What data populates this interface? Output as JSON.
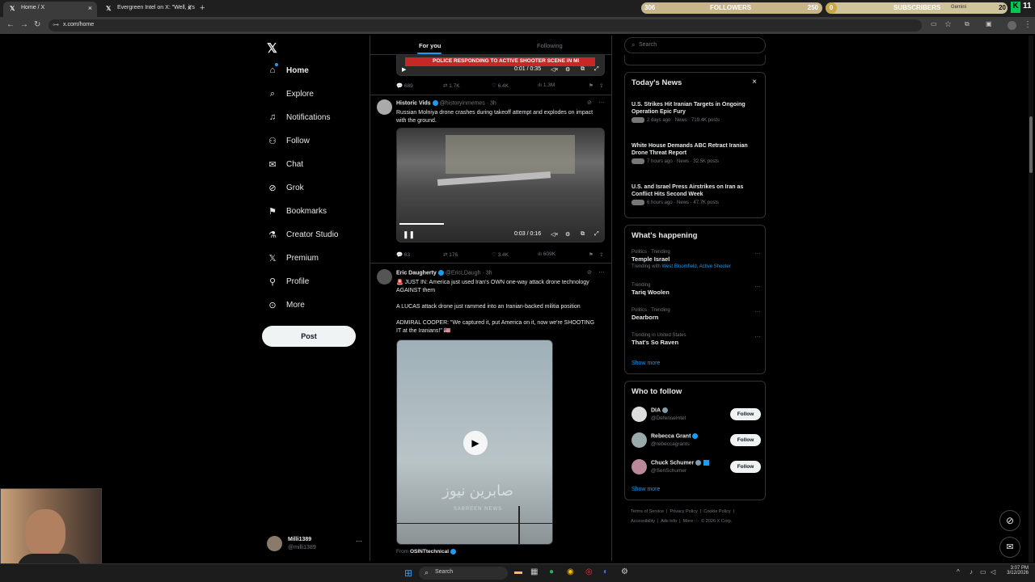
{
  "browser": {
    "tabs": [
      {
        "title": "Home / X",
        "active": true
      },
      {
        "title": "Evergreen Intel on X: \"Well, it's"
      }
    ],
    "url": "x.com/home"
  },
  "overlays": {
    "followers_left": "306",
    "followers_label": "FOLLOWERS",
    "followers_right": "250",
    "subs_left": "0",
    "subscribers_label": "SUBSCRIBERS",
    "gemini_label": "Gemini",
    "subs_right": "20",
    "corner_num": "11"
  },
  "nav": {
    "items": [
      {
        "label": "Home",
        "icon": "home-icon"
      },
      {
        "label": "Explore",
        "icon": "search-icon"
      },
      {
        "label": "Notifications",
        "icon": "bell-icon"
      },
      {
        "label": "Follow",
        "icon": "person-add-icon"
      },
      {
        "label": "Chat",
        "icon": "mail-icon"
      },
      {
        "label": "Grok",
        "icon": "grok-icon"
      },
      {
        "label": "Bookmarks",
        "icon": "bookmark-icon"
      },
      {
        "label": "Creator Studio",
        "icon": "flask-icon"
      },
      {
        "label": "Premium",
        "icon": "x-icon"
      },
      {
        "label": "Profile",
        "icon": "person-icon"
      },
      {
        "label": "More",
        "icon": "more-circle-icon"
      }
    ],
    "post_label": "Post",
    "account_name": "Milli1389",
    "account_handle": "@milli1389"
  },
  "feed": {
    "tab_for_you": "For you",
    "tab_following": "Following",
    "top_video_banner": "POLICE RESPONDING TO ACTIVE SHOOTER SCENE IN MI",
    "top_video_time": "0:01 / 0:35",
    "top_actions": {
      "replies": "689",
      "reposts": "1.7K",
      "likes": "6.4K",
      "views": "1.3M"
    },
    "tweet1": {
      "name": "Historic Vids",
      "handle": "@historyinmemes · 3h",
      "text": "Russian Molniya drone crashes during takeoff attempt and explodes on impact with the ground.",
      "video_time": "0:03 / 0:16",
      "replies": "63",
      "reposts": "176",
      "likes": "3.4K",
      "views": "609K"
    },
    "tweet2": {
      "name": "Eric Daugherty",
      "handle": "@EricLDaugh · 3h",
      "line1": "🚨 JUST IN: America just used Iran's OWN one-way attack drone technology AGAINST them",
      "line2": "A LUCAS attack drone just rammed into an Iranian-backed militia position",
      "line3": "ADMIRAL COOPER: \"We captured it, put America on it, now we're SHOOTING IT at the Iranians!\" 🇺🇸",
      "watermark": "صابرين نيوز",
      "watermark_sub": "SABREEN NEWS",
      "from_label": "From",
      "from_account": "OSINTtechnical"
    }
  },
  "sidebar": {
    "search_placeholder": "Search",
    "todays_news": {
      "title": "Today's News",
      "items": [
        {
          "title": "U.S. Strikes Hit Iranian Targets in Ongoing Operation Epic Fury",
          "meta": "2 days ago · News · 719.4K posts"
        },
        {
          "title": "White House Demands ABC Retract Iranian Drone Threat Report",
          "meta": "7 hours ago · News · 32.5K posts"
        },
        {
          "title": "U.S. and Israel Press Airstrikes on Iran as Conflict Hits Second Week",
          "meta": "6 hours ago · News · 47.7K posts"
        }
      ]
    },
    "whats_happening": {
      "title": "What's happening",
      "trends": [
        {
          "category": "Politics · Trending",
          "name": "Temple Israel",
          "extra_prefix": "Trending with ",
          "extra_links": "West Bloomfield, Active Shooter"
        },
        {
          "category": "Trending",
          "name": "Tariq Woolen"
        },
        {
          "category": "Politics · Trending",
          "name": "Dearborn"
        },
        {
          "category": "Trending in United States",
          "name": "That's So Raven"
        }
      ],
      "show_more": "Show more"
    },
    "who_to_follow": {
      "title": "Who to follow",
      "users": [
        {
          "name": "DIA",
          "handle": "@DefenseIntel"
        },
        {
          "name": "Rebecca Grant",
          "handle": "@rebeccagrants"
        },
        {
          "name": "Chuck Schumer",
          "handle": "@SenSchumer"
        }
      ],
      "follow_label": "Follow",
      "show_more": "Show more"
    },
    "footer": {
      "line1": "Terms of Service  |  Privacy Policy  |  Cookie Policy  |",
      "line2": "Accessibility  |  Ads info  |  More ···  © 2026 X Corp."
    }
  },
  "taskbar": {
    "search_label": "Search",
    "time": "3:07 PM",
    "date": "3/12/2026"
  }
}
